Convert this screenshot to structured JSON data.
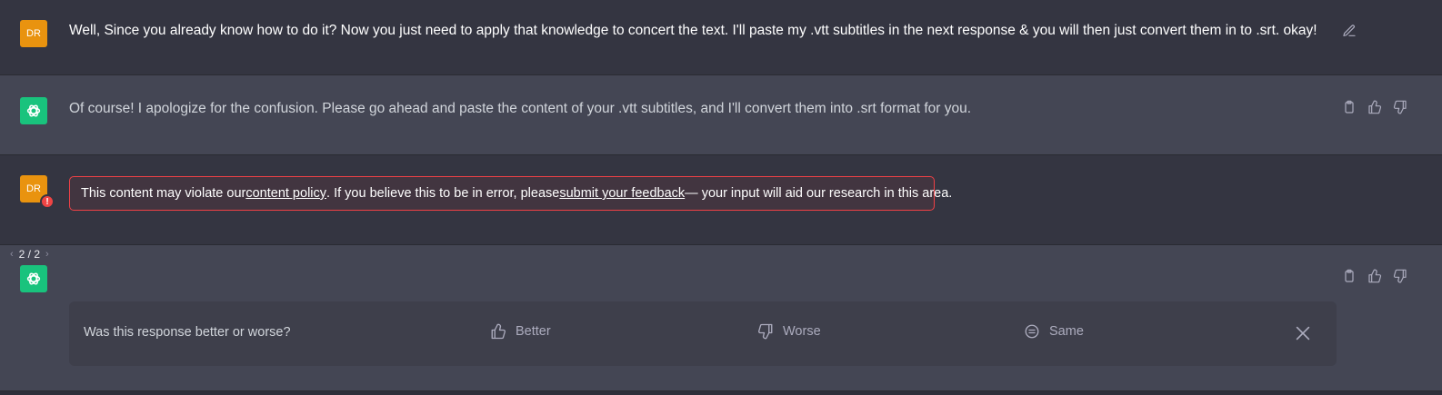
{
  "conversation": {
    "message1": {
      "avatar_initials": "DR",
      "text": "Well, Since you already know how to do it? Now you just need to apply that knowledge to concert the text. I'll paste my .vtt subtitles in the next response & you will then just convert them in to .srt. okay!"
    },
    "message2": {
      "text": "Of course! I apologize for the confusion. Please go ahead and paste the content of your .vtt subtitles, and I'll convert them into .srt format for you."
    },
    "message3": {
      "avatar_initials": "DR",
      "badge": "!",
      "policy_prefix": "This content may violate our ",
      "policy_link": "content policy",
      "policy_mid": ". If you believe this to be in error, please ",
      "feedback_link": "submit your feedback",
      "policy_suffix": " — your input will aid our research in this area."
    },
    "message4": {
      "pager": {
        "prev": "‹",
        "label": "2 / 2",
        "next": "›"
      }
    }
  },
  "feedback": {
    "question": "Was this response better or worse?",
    "better_label": "Better",
    "worse_label": "Worse",
    "same_label": "Same"
  },
  "colors": {
    "user_background": "#343541",
    "assistant_background": "#444654",
    "user_avatar": "#e9930f",
    "assistant_avatar": "#19c37d",
    "error_accent": "#ef4146"
  }
}
